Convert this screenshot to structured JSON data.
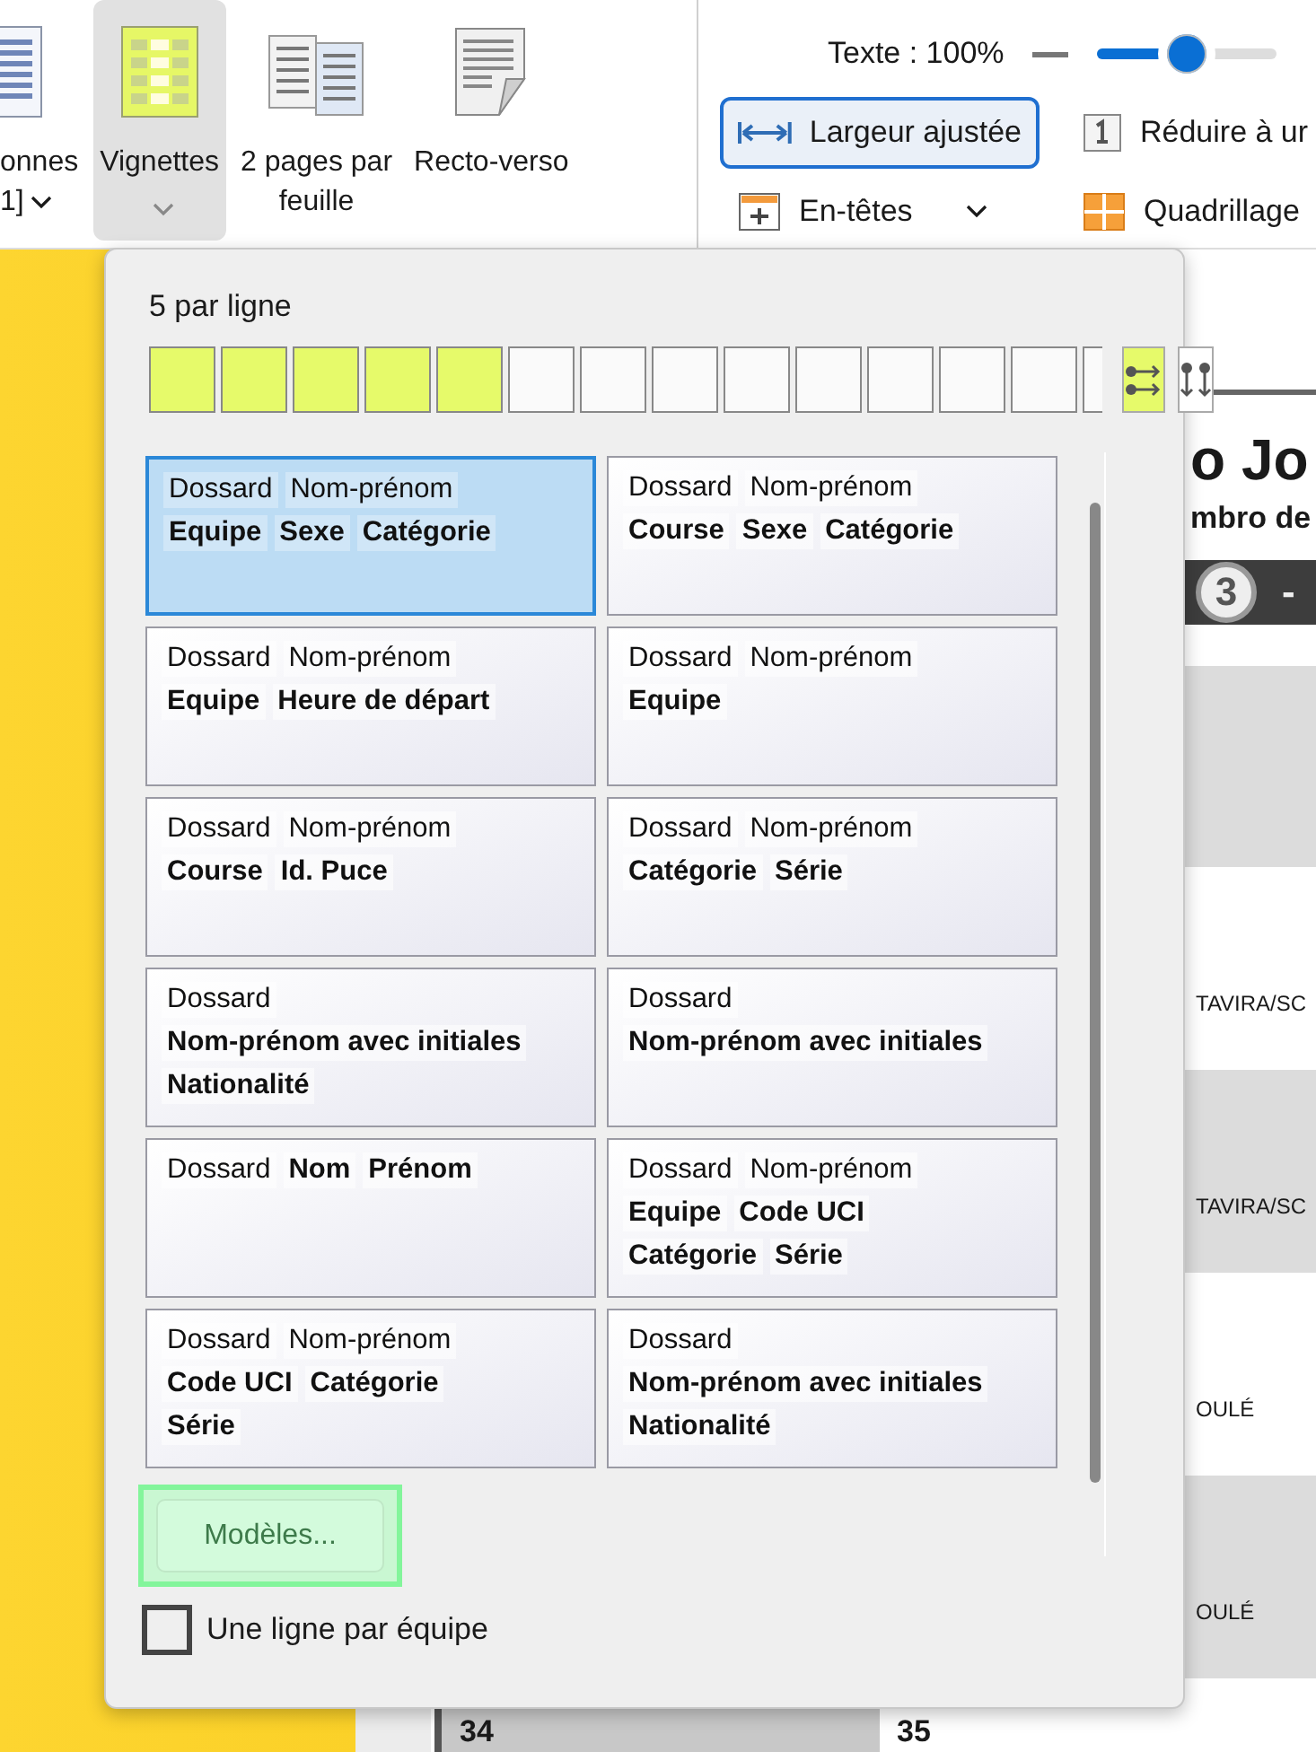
{
  "ribbon": {
    "layout_buttons": [
      {
        "lines": [
          "onnes",
          "1]"
        ],
        "dropdown": true,
        "selected": false
      },
      {
        "lines": [
          "Vignettes"
        ],
        "dropdown": true,
        "selected": true
      },
      {
        "lines": [
          "2 pages par",
          "feuille"
        ],
        "dropdown": false,
        "selected": false
      },
      {
        "lines": [
          "Recto-verso"
        ],
        "dropdown": false,
        "selected": false
      }
    ],
    "text_zoom": {
      "label": "Texte : 100%",
      "level": 0.5
    },
    "view_buttons": [
      {
        "label": "Largeur ajustée",
        "selected": true,
        "dropdown": false
      },
      {
        "label": "Réduire à ur",
        "selected": false,
        "dropdown": false
      },
      {
        "label": "En-têtes",
        "selected": false,
        "dropdown": true
      },
      {
        "label": "Quadrillage",
        "selected": false,
        "dropdown": false
      }
    ]
  },
  "document": {
    "title": "o Jo",
    "subtitle": "mbro de",
    "section_number": "3",
    "section_dash": "-",
    "rows": [
      "TAVIRA/SC",
      "TAVIRA/SC",
      "OULÉ",
      "OULÉ"
    ],
    "bottom_cells": [
      "34",
      "35"
    ]
  },
  "thumbnail_popup": {
    "per_row_label": "5 par ligne",
    "per_row_cells": [
      {
        "selected": true
      },
      {
        "selected": true
      },
      {
        "selected": true
      },
      {
        "selected": true
      },
      {
        "selected": true
      },
      {
        "selected": false
      },
      {
        "selected": false
      },
      {
        "selected": false
      },
      {
        "selected": false
      },
      {
        "selected": false
      },
      {
        "selected": false
      },
      {
        "selected": false
      },
      {
        "selected": false
      },
      {
        "selected": false
      }
    ],
    "order_buttons": [
      {
        "kind": "horizontal",
        "selected": true
      },
      {
        "kind": "vertical",
        "selected": false
      }
    ],
    "templates": [
      {
        "selected": true,
        "lines": [
          [
            {
              "text": "Dossard",
              "bold": false
            },
            {
              "text": "Nom-prénom",
              "bold": false
            }
          ],
          [
            {
              "text": "Equipe",
              "bold": true
            },
            {
              "text": "Sexe",
              "bold": true
            },
            {
              "text": "Catégorie",
              "bold": true
            }
          ]
        ]
      },
      {
        "selected": false,
        "lines": [
          [
            {
              "text": "Dossard",
              "bold": false
            },
            {
              "text": "Nom-prénom",
              "bold": false
            }
          ],
          [
            {
              "text": "Course",
              "bold": true
            },
            {
              "text": "Sexe",
              "bold": true
            },
            {
              "text": "Catégorie",
              "bold": true
            }
          ]
        ]
      },
      {
        "selected": false,
        "lines": [
          [
            {
              "text": "Dossard",
              "bold": false
            },
            {
              "text": "Nom-prénom",
              "bold": false
            }
          ],
          [
            {
              "text": "Equipe",
              "bold": true
            },
            {
              "text": "Heure de départ",
              "bold": true
            }
          ]
        ]
      },
      {
        "selected": false,
        "lines": [
          [
            {
              "text": "Dossard",
              "bold": false
            },
            {
              "text": "Nom-prénom",
              "bold": false
            }
          ],
          [
            {
              "text": "Equipe",
              "bold": true
            }
          ]
        ]
      },
      {
        "selected": false,
        "lines": [
          [
            {
              "text": "Dossard",
              "bold": false
            },
            {
              "text": "Nom-prénom",
              "bold": false
            }
          ],
          [
            {
              "text": "Course",
              "bold": true
            },
            {
              "text": "Id. Puce",
              "bold": true
            }
          ]
        ]
      },
      {
        "selected": false,
        "lines": [
          [
            {
              "text": "Dossard",
              "bold": false
            },
            {
              "text": "Nom-prénom",
              "bold": false
            }
          ],
          [
            {
              "text": "Catégorie",
              "bold": true
            },
            {
              "text": "Série",
              "bold": true
            }
          ]
        ]
      },
      {
        "selected": false,
        "lines": [
          [
            {
              "text": "Dossard",
              "bold": false
            }
          ],
          [
            {
              "text": "Nom-prénom avec initiales",
              "bold": true
            }
          ],
          [
            {
              "text": "Nationalité",
              "bold": true
            }
          ]
        ]
      },
      {
        "selected": false,
        "lines": [
          [
            {
              "text": "Dossard",
              "bold": false
            }
          ],
          [
            {
              "text": "Nom-prénom avec initiales",
              "bold": true
            }
          ]
        ]
      },
      {
        "selected": false,
        "lines": [
          [
            {
              "text": "Dossard",
              "bold": false
            },
            {
              "text": "Nom",
              "bold": true
            },
            {
              "text": "Prénom",
              "bold": true
            }
          ]
        ]
      },
      {
        "selected": false,
        "lines": [
          [
            {
              "text": "Dossard",
              "bold": false
            },
            {
              "text": "Nom-prénom",
              "bold": false
            }
          ],
          [
            {
              "text": "Equipe",
              "bold": true
            },
            {
              "text": "Code UCI",
              "bold": true
            }
          ],
          [
            {
              "text": "Catégorie",
              "bold": true
            },
            {
              "text": "Série",
              "bold": true
            }
          ]
        ]
      },
      {
        "selected": false,
        "lines": [
          [
            {
              "text": "Dossard",
              "bold": false
            },
            {
              "text": "Nom-prénom",
              "bold": false
            }
          ],
          [
            {
              "text": "Code UCI",
              "bold": true
            },
            {
              "text": "Catégorie",
              "bold": true
            }
          ],
          [
            {
              "text": "Série",
              "bold": true
            }
          ]
        ]
      },
      {
        "selected": false,
        "lines": [
          [
            {
              "text": "Dossard",
              "bold": false
            }
          ],
          [
            {
              "text": "Nom-prénom avec initiales",
              "bold": true
            }
          ],
          [
            {
              "text": "Nationalité",
              "bold": true
            }
          ]
        ]
      }
    ],
    "models_button": {
      "label": "Modèles...",
      "focused": true
    },
    "one_line_per_team": {
      "label": "Une ligne par équipe",
      "checked": false
    }
  }
}
